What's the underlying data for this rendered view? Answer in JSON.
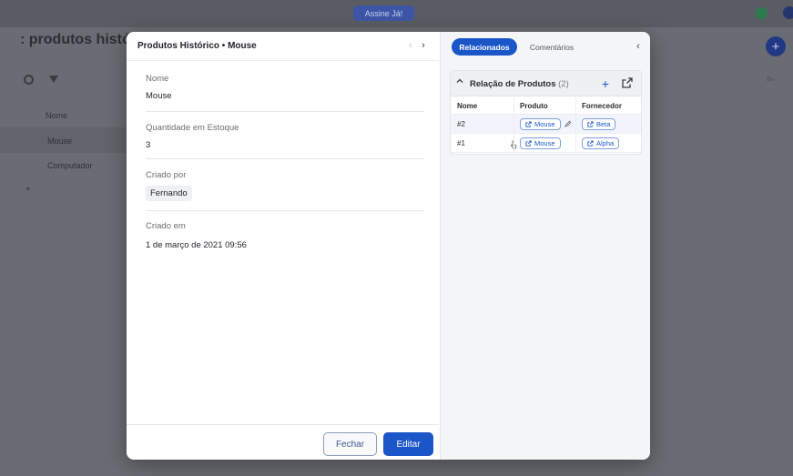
{
  "background": {
    "badge": "Assine Já!",
    "title": ": produtos históric",
    "subtitle": "",
    "column": "Nome",
    "rows": [
      "Mouse",
      "Computador"
    ],
    "right_text": "Bu"
  },
  "modal": {
    "title": "Produtos Histórico • Mouse",
    "fields": [
      {
        "label": "Nome",
        "value": "Mouse"
      },
      {
        "label": "Quantidade em Estoque",
        "value": "3"
      },
      {
        "label": "Criado por",
        "value": "Fernando"
      },
      {
        "label": "Criado em",
        "value": "1 de março de 2021 09:56"
      }
    ],
    "buttons": {
      "close": "Fechar",
      "edit": "Editar"
    }
  },
  "sidepanel": {
    "tabs": [
      {
        "label": "Relacionados"
      },
      {
        "label": "Comentários"
      }
    ],
    "card": {
      "title": "Relação de Produtos",
      "count": "(2)",
      "columns": [
        "Nome",
        "Produto",
        "Fornecedor"
      ],
      "rows": [
        {
          "nome": "#2",
          "produto": "Mouse",
          "fornecedor": "Beta"
        },
        {
          "nome": "#1",
          "produto": "Mouse",
          "fornecedor": "Alpha"
        }
      ]
    }
  },
  "colors": {
    "accent": "#1b56c8",
    "overlay": "#6a6c73"
  }
}
